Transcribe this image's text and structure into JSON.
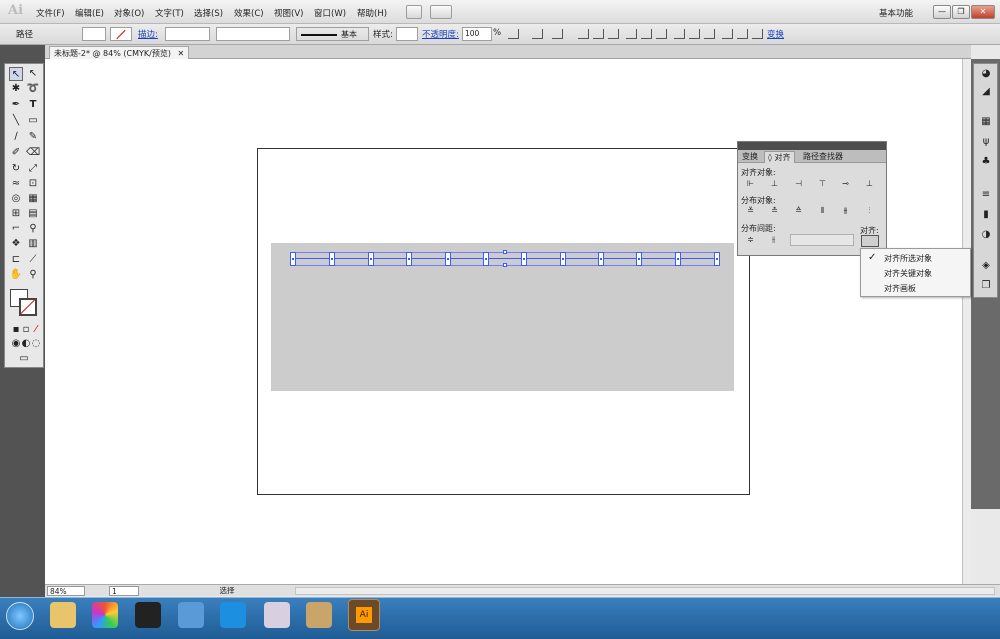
{
  "app": {
    "logo": "Ai"
  },
  "menus": [
    "文件(F)",
    "编辑(E)",
    "对象(O)",
    "文字(T)",
    "选择(S)",
    "效果(C)",
    "视图(V)",
    "窗口(W)",
    "帮助(H)"
  ],
  "workspace": "基本功能",
  "window_buttons": [
    "—",
    "❐",
    "✕"
  ],
  "control": {
    "object_type": "路径",
    "stroke_label": "描边:",
    "stroke_profile": "基本",
    "style_label": "样式:",
    "opacity_label": "不透明度:",
    "opacity_value": "100",
    "opacity_unit": "%",
    "transform_link": "变换"
  },
  "doc_tab": {
    "title": "未标题-2* @ 84% (CMYK/预览)",
    "close": "✕"
  },
  "status": {
    "zoom": "84%",
    "page": "1",
    "state": "选择"
  },
  "align_panel": {
    "tabs": [
      "变换",
      "◊ 对齐",
      "路径查找器"
    ],
    "align_objects": "对齐对象:",
    "distribute_objects": "分布对象:",
    "distribute_spacing": "分布间距:",
    "align_to": "对齐:"
  },
  "dropdown": {
    "items": [
      "对齐所选对象",
      "对齐关键对象",
      "对齐画板"
    ],
    "checked_index": 0,
    "check": "✓"
  },
  "colors": {
    "selection": "#3d5bff",
    "artboard_rect": "#cccccc",
    "gutter": "#535353"
  }
}
